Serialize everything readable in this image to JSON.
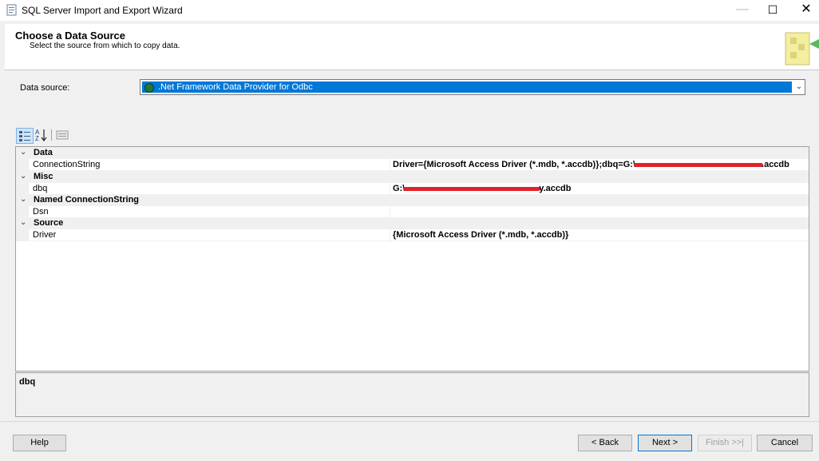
{
  "window": {
    "title": "SQL Server Import and Export Wizard"
  },
  "header": {
    "title": "Choose a Data Source",
    "subtitle": "Select the source from which to copy data."
  },
  "data_source": {
    "label": "Data source:",
    "selected": ".Net Framework Data Provider for Odbc"
  },
  "property_grid": {
    "categories": [
      {
        "name": "Data",
        "properties": [
          {
            "name": "ConnectionString",
            "value_prefix": "Driver={Microsoft Access Driver (*.mdb, *.accdb)};dbq=G:\\",
            "value_suffix": ".accdb"
          }
        ]
      },
      {
        "name": "Misc",
        "properties": [
          {
            "name": "dbq",
            "value_prefix": "G:\\",
            "value_suffix": "y.accdb"
          }
        ]
      },
      {
        "name": "Named ConnectionString",
        "properties": [
          {
            "name": "Dsn",
            "value": ""
          }
        ]
      },
      {
        "name": "Source",
        "properties": [
          {
            "name": "Driver",
            "value": "{Microsoft Access Driver (*.mdb, *.accdb)}"
          }
        ]
      }
    ]
  },
  "description": {
    "title": "dbq"
  },
  "buttons": {
    "help": "Help",
    "back": "< Back",
    "next": "Next >",
    "finish": "Finish >>|",
    "cancel": "Cancel"
  }
}
